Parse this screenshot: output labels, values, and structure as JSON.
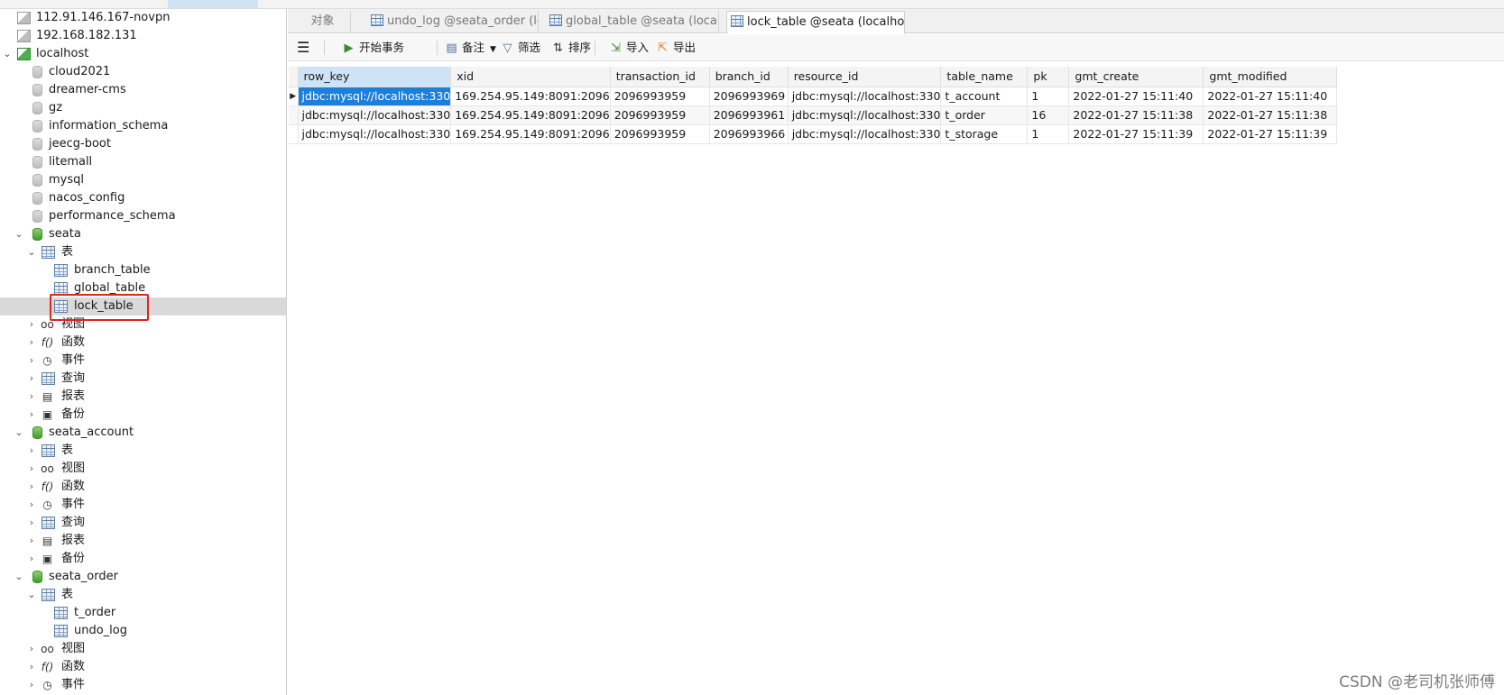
{
  "sidebar": {
    "items": [
      {
        "label": "112.91.146.167-novpn"
      },
      {
        "label": "192.168.182.131"
      },
      {
        "label": "localhost"
      },
      {
        "label": "cloud2021"
      },
      {
        "label": "dreamer-cms"
      },
      {
        "label": "gz"
      },
      {
        "label": "information_schema"
      },
      {
        "label": "jeecg-boot"
      },
      {
        "label": "litemall"
      },
      {
        "label": "mysql"
      },
      {
        "label": "nacos_config"
      },
      {
        "label": "performance_schema"
      },
      {
        "label": "seata"
      },
      {
        "label": "表"
      },
      {
        "label": "branch_table"
      },
      {
        "label": "global_table"
      },
      {
        "label": "lock_table"
      },
      {
        "label": "视图"
      },
      {
        "label": "函数"
      },
      {
        "label": "事件"
      },
      {
        "label": "查询"
      },
      {
        "label": "报表"
      },
      {
        "label": "备份"
      },
      {
        "label": "seata_account"
      },
      {
        "label": "表"
      },
      {
        "label": "视图"
      },
      {
        "label": "函数"
      },
      {
        "label": "事件"
      },
      {
        "label": "查询"
      },
      {
        "label": "报表"
      },
      {
        "label": "备份"
      },
      {
        "label": "seata_order"
      },
      {
        "label": "表"
      },
      {
        "label": "t_order"
      },
      {
        "label": "undo_log"
      },
      {
        "label": "视图"
      },
      {
        "label": "函数"
      },
      {
        "label": "事件"
      }
    ]
  },
  "tabs": [
    {
      "label": "对象"
    },
    {
      "label": "undo_log @seata_order (lo..."
    },
    {
      "label": "global_table @seata (localh..."
    },
    {
      "label": "lock_table @seata (localhos..."
    }
  ],
  "toolbar": {
    "begin_transaction": "开始事务",
    "note": "备注",
    "filter": "筛选",
    "sort": "排序",
    "import": "导入",
    "export": "导出"
  },
  "grid": {
    "columns": [
      "row_key",
      "xid",
      "transaction_id",
      "branch_id",
      "resource_id",
      "table_name",
      "pk",
      "gmt_create",
      "gmt_modified"
    ],
    "rows": [
      [
        "jdbc:mysql://localhost:330",
        "169.254.95.149:8091:2096",
        "2096993959",
        "2096993969",
        "jdbc:mysql://localhost:330",
        "t_account",
        "1",
        "2022-01-27 15:11:40",
        "2022-01-27 15:11:40"
      ],
      [
        "jdbc:mysql://localhost:330",
        "169.254.95.149:8091:2096",
        "2096993959",
        "2096993961",
        "jdbc:mysql://localhost:330",
        "t_order",
        "16",
        "2022-01-27 15:11:38",
        "2022-01-27 15:11:38"
      ],
      [
        "jdbc:mysql://localhost:330",
        "169.254.95.149:8091:2096",
        "2096993959",
        "2096993966",
        "jdbc:mysql://localhost:330",
        "t_storage",
        "1",
        "2022-01-27 15:11:39",
        "2022-01-27 15:11:39"
      ]
    ]
  },
  "watermark": "CSDN @老司机张师傅",
  "colors": {
    "selection": "#1e7fdb",
    "highlight_box": "#e5231f",
    "selected_row": "#d9d9d9"
  }
}
